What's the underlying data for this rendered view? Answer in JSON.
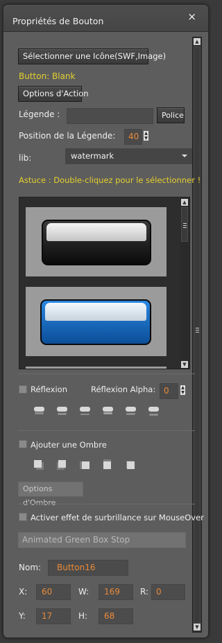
{
  "window": {
    "title": "Propriétés de Bouton",
    "close_glyph": "×"
  },
  "buttons": {
    "select_icon": "Sélectionner une Icône(SWF,Image)",
    "action_options": "Options d'Action",
    "police": "Police",
    "shadow_options": "Options d'Ombre"
  },
  "button_status": "Button: Blank",
  "caption": {
    "label": "Légende :",
    "value": ""
  },
  "caption_position": {
    "label": "Position de la Légende:",
    "value": "40"
  },
  "lib": {
    "label": "lib:",
    "value": "watermark"
  },
  "tip": "Astuce : Double-cliquez pour le sélectionner !",
  "reflection": {
    "label": "Réflexion",
    "checked": false,
    "alpha_label": "Réflexion Alpha:",
    "alpha_value": "0"
  },
  "shadow": {
    "label": "Ajouter une Ombre",
    "checked": false
  },
  "highlight": {
    "label": "Activer effet de surbrillance sur MouseOver",
    "checked": false
  },
  "effect_value": "Animated Green Box Stop",
  "name": {
    "label": "Nom:",
    "value": "Button16"
  },
  "geometry": {
    "x_label": "X:",
    "x": "60",
    "w_label": "W:",
    "w": "169",
    "r_label": "R:",
    "r": "0",
    "y_label": "Y:",
    "y": "17",
    "h_label": "H:",
    "h": "68"
  },
  "colors": {
    "accent_orange": "#e98a3a",
    "accent_yellow": "#e4cf2e",
    "blue_button": "#1a6fc4"
  }
}
